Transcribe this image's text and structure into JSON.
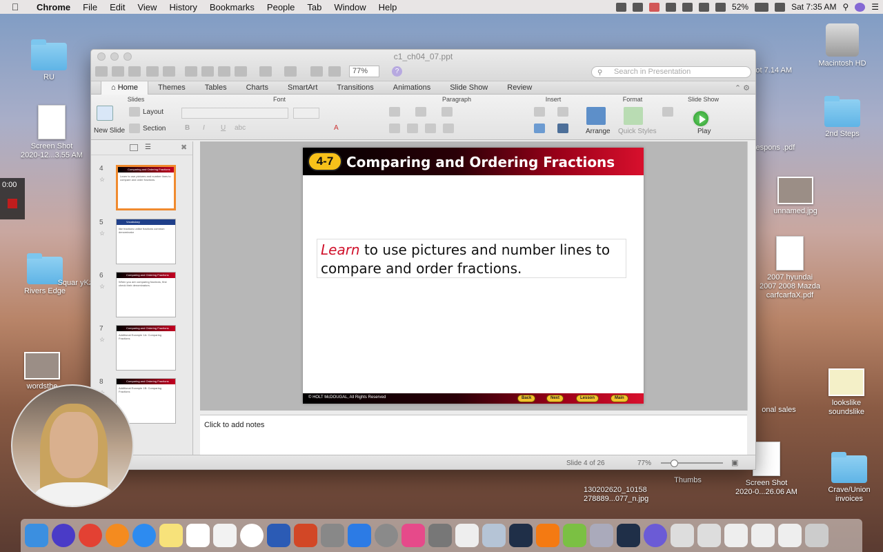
{
  "menubar": {
    "app": "Chrome",
    "items": [
      "File",
      "Edit",
      "View",
      "History",
      "Bookmarks",
      "People",
      "Tab",
      "Window",
      "Help"
    ],
    "battery": "52%",
    "clock": "Sat 7:35 AM"
  },
  "desktop": {
    "icons": [
      {
        "label": "RU",
        "type": "folder"
      },
      {
        "label": "Screen Shot 2020-12...3.55 AM",
        "type": "doc"
      },
      {
        "label": "Rivers Edge",
        "type": "folder"
      },
      {
        "label": "wordsthe",
        "type": "img"
      },
      {
        "label": "Macintosh HD",
        "type": "hd"
      },
      {
        "label": "2nd Steps",
        "type": "folder"
      },
      {
        "label": "unnamed.jpg",
        "type": "img"
      },
      {
        "label": "2007 hyundai 2007 2008 Mazda carfcarfaX.pdf",
        "type": "doc"
      },
      {
        "label": "lookslike soundslike",
        "type": "img"
      },
      {
        "label": "Screen Shot 2020-0...26.06 AM",
        "type": "doc"
      },
      {
        "label": "Crave/Union invoices",
        "type": "folder"
      },
      {
        "label": "Thumbs",
        "type": "folder"
      },
      {
        "label": "130202620_10158 278889...077_n.jpg",
        "type": "img"
      },
      {
        "label": "onal sales",
        "type": "doc"
      },
      {
        "label": "Shot 7.14 AM",
        "type": "doc"
      },
      {
        "label": "_respons .pdf",
        "type": "doc"
      },
      {
        "label": "Squar yKzn",
        "type": "doc"
      }
    ]
  },
  "recording": {
    "time": "0:00"
  },
  "window": {
    "title": "c1_ch04_07.ppt",
    "zoom": "77%",
    "search_placeholder": "Search in Presentation",
    "tabs": [
      "Home",
      "Themes",
      "Tables",
      "Charts",
      "SmartArt",
      "Transitions",
      "Animations",
      "Slide Show",
      "Review"
    ],
    "ribbon": {
      "groups": [
        "Slides",
        "Font",
        "Paragraph",
        "Insert",
        "Format",
        "Slide Show"
      ],
      "new_slide": "New Slide",
      "layout": "Layout",
      "section": "Section",
      "arrange": "Arrange",
      "quick_styles": "Quick Styles",
      "play": "Play"
    },
    "slides": [
      {
        "num": "4",
        "title": "Comparing and Ordering Fractions",
        "text": "Learn to use pictures and number lines to compare and order fractions."
      },
      {
        "num": "5",
        "title": "Vocabulary",
        "text": "like fractions unlike fractions common denominator"
      },
      {
        "num": "6",
        "title": "Comparing and Ordering Fractions",
        "text": "When you are comparing fractions, first check their denominators."
      },
      {
        "num": "7",
        "title": "Comparing and Ordering Fractions",
        "text": "Additional Example 1A: Comparing Fractions"
      },
      {
        "num": "8",
        "title": "Comparing and Ordering Fractions",
        "text": "Additional Example 1B: Comparing Fractions"
      }
    ],
    "current_slide": {
      "badge": "4-7",
      "title": "Comparing and Ordering Fractions",
      "learn": "Learn",
      "body": " to use pictures and number lines to compare and order fractions.",
      "copyright": "© HOLT McDOUGAL, All Rights Reserved",
      "nav": [
        "Back",
        "Next",
        "Lesson",
        "Main"
      ]
    },
    "notes": "Click to add notes",
    "status": {
      "slide": "Slide 4 of 26",
      "zoom": "77%"
    }
  }
}
